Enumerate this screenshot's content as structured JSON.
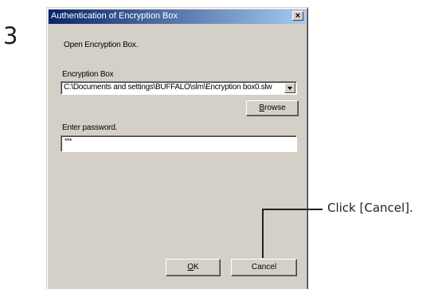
{
  "step": {
    "number": "3"
  },
  "dialog": {
    "title": "Authentication of Encryption Box",
    "close_glyph": "×",
    "instruction": "Open Encryption Box.",
    "box_label": "Encryption Box",
    "box_path": "C:\\Documents and settings\\BUFFALO\\slm\\Encryption box0.slw",
    "browse_label": {
      "accel": "B",
      "rest": "rowse"
    },
    "password_label": "Enter password.",
    "password_value": "***",
    "ok_label": {
      "accel": "O",
      "rest": "K"
    },
    "cancel_label": "Cancel"
  },
  "callout": {
    "text": "Click [Cancel]."
  }
}
